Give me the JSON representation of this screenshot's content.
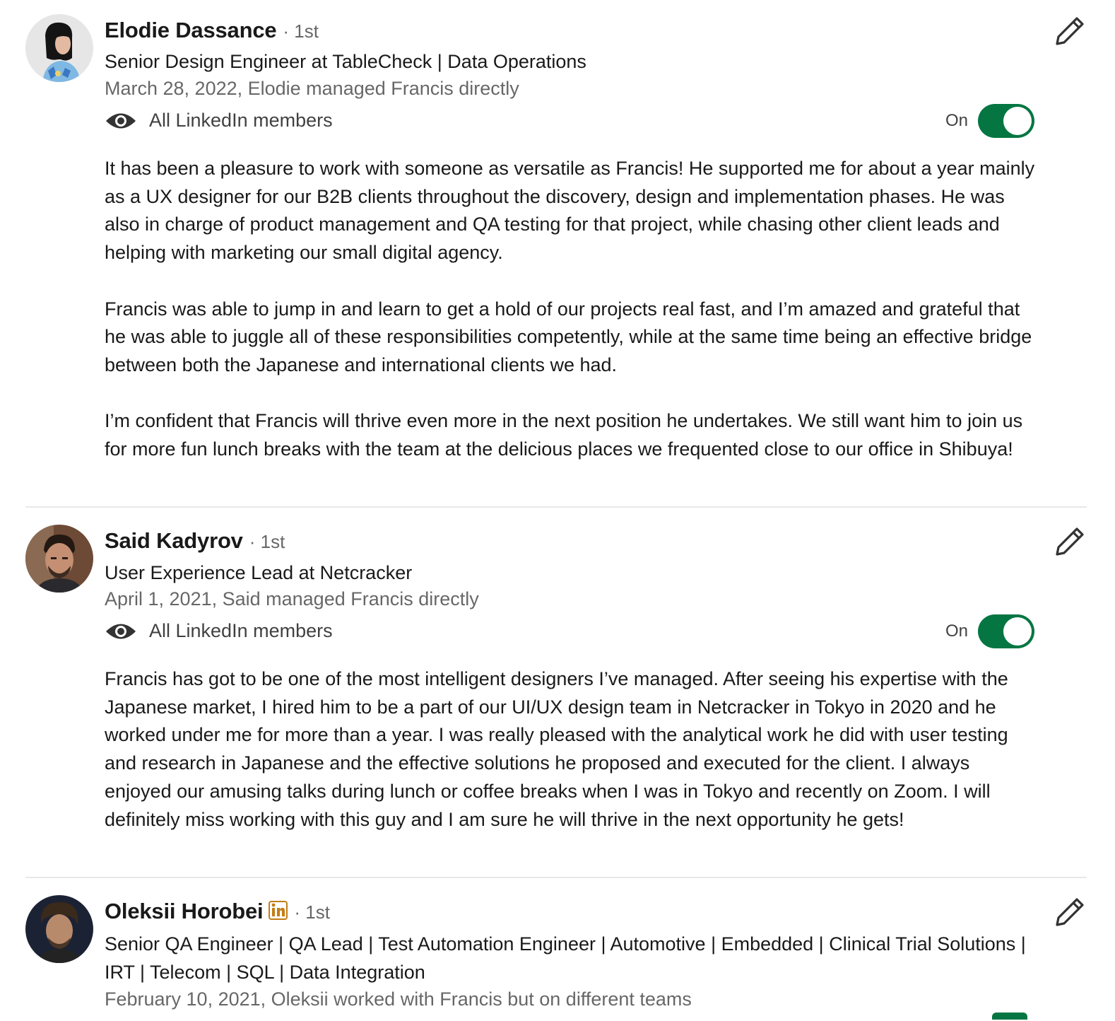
{
  "recommendations": [
    {
      "name": "Elodie Dassance",
      "degree": "· 1st",
      "headline": "Senior Design Engineer at TableCheck | Data Operations",
      "meta": "March 28, 2022, Elodie managed Francis directly",
      "visibility": "All LinkedIn members",
      "toggle_label": "On",
      "paragraphs": [
        "It has been a pleasure to work with someone as versatile as Francis! He supported me for about a year mainly as a UX designer for our B2B clients throughout the discovery, design and implementation phases. He was also in charge of product management and QA testing for that project, while chasing other client leads and helping with marketing our small digital agency.",
        "Francis was able to jump in and learn to get a hold of our projects real fast, and I’m amazed and grateful that he was able to juggle all of these responsibilities competently, while at the same time being an effective bridge between both the Japanese and international clients we had.",
        "I’m confident that Francis will thrive even more in the next position he undertakes. We still want him to join us for more fun lunch breaks with the team at the delicious places we frequented close to our office in Shibuya!"
      ]
    },
    {
      "name": "Said Kadyrov",
      "degree": "· 1st",
      "headline": "User Experience Lead at Netcracker",
      "meta": "April 1, 2021, Said managed Francis directly",
      "visibility": "All LinkedIn members",
      "toggle_label": "On",
      "paragraphs": [
        "Francis has got to be one of the most intelligent designers I’ve managed. After seeing his expertise with the Japanese market, I hired him to be a part of our UI/UX design team in Netcracker in Tokyo in 2020 and he worked under me for more than a year. I was really pleased with the analytical work he did with user testing and research in Japanese and the effective solutions he proposed and executed for the client. I always enjoyed our amusing talks during lunch or coffee breaks when I was in Tokyo and recently on Zoom. I will definitely miss working with this guy and I am sure he will thrive in the next opportunity he gets!"
      ]
    },
    {
      "name": "Oleksii Horobei",
      "degree": "· 1st",
      "badge": "in",
      "headline": "Senior QA Engineer | QA Lead | Test Automation Engineer | Automotive | Embedded | Clinical Trial Solutions | IRT | Telecom | SQL | Data Integration",
      "meta": "February 10, 2021, Oleksii worked with Francis but on different teams"
    }
  ],
  "icons": {
    "visibility": "eye-icon",
    "edit": "pencil-icon",
    "badge": "linkedin-icon"
  },
  "colors": {
    "toggle_on": "#057642",
    "badge": "#c37d16",
    "divider": "#e8e8e8"
  }
}
